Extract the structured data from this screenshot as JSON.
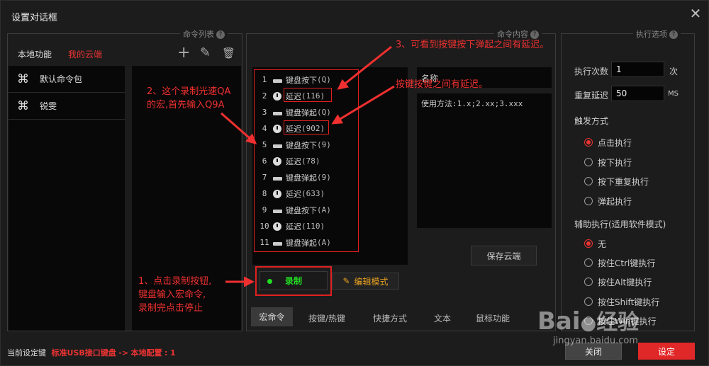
{
  "window": {
    "title": "设置对话框",
    "close_label": "✕"
  },
  "command_list": {
    "legend": "命令列表",
    "tabs": {
      "local": "本地功能",
      "cloud": "我的云端"
    },
    "tools": {
      "add": "+",
      "edit": "✎",
      "delete": "🗑"
    },
    "packages": [
      {
        "icon": "⌘",
        "label": "默认命令包"
      },
      {
        "icon": "⌘",
        "label": "锐雯"
      }
    ]
  },
  "command_content": {
    "legend": "命令内容",
    "macro_rows": [
      {
        "num": "1",
        "icon": "keyboard-icon",
        "label": "键盘按下",
        "arg": "(Q)"
      },
      {
        "num": "2",
        "icon": "clock-icon",
        "label": "延迟",
        "arg": "(116)"
      },
      {
        "num": "3",
        "icon": "keyboard-icon",
        "label": "键盘弹起",
        "arg": "(Q)"
      },
      {
        "num": "4",
        "icon": "clock-icon",
        "label": "延迟",
        "arg": "(902)"
      },
      {
        "num": "5",
        "icon": "keyboard-icon",
        "label": "键盘按下",
        "arg": "(9)"
      },
      {
        "num": "6",
        "icon": "clock-icon",
        "label": "延迟",
        "arg": "(78)"
      },
      {
        "num": "7",
        "icon": "keyboard-icon",
        "label": "键盘弹起",
        "arg": "(9)"
      },
      {
        "num": "8",
        "icon": "clock-icon",
        "label": "延迟",
        "arg": "(633)"
      },
      {
        "num": "9",
        "icon": "keyboard-icon",
        "label": "键盘按下",
        "arg": "(A)"
      },
      {
        "num": "10",
        "icon": "clock-icon",
        "label": "延迟",
        "arg": "(110)"
      },
      {
        "num": "11",
        "icon": "keyboard-icon",
        "label": "键盘弹起",
        "arg": "(A)"
      }
    ],
    "name_label": "名称",
    "usage_text": "使用方法:1.x;2.xx;3.xxx",
    "save_cloud": "保存云端",
    "record_button": "录制",
    "edit_mode_button": "编辑模式",
    "bottom_tabs": [
      "宏命令",
      "按键/热键",
      "快捷方式",
      "文本",
      "鼠标功能"
    ]
  },
  "exec_options": {
    "legend": "执行选项",
    "exec_count_label": "执行次数",
    "exec_count_value": "1",
    "exec_count_unit": "次",
    "repeat_delay_label": "重复延迟",
    "repeat_delay_value": "50",
    "repeat_delay_unit": "MS",
    "trigger_title": "触发方式",
    "trigger_options": [
      "点击执行",
      "按下执行",
      "按下重复执行",
      "弹起执行"
    ],
    "assist_title": "辅助执行(适用软件模式)",
    "assist_options": [
      "无",
      "按住Ctrl键执行",
      "按住Alt键执行",
      "按住Shift键执行",
      "按住Win键执行"
    ]
  },
  "footer": {
    "label": "当前设定键",
    "device": "标准USB接口键盘",
    "arrow": "->",
    "config": "本地配置",
    "sep": ":",
    "num": "1",
    "close_button": "关闭",
    "set_button": "设定"
  },
  "annotations": {
    "a1": [
      "1、点击录制按钮,",
      "键盘输入宏命令,",
      "录制完点击停止"
    ],
    "a2": [
      "2、这个录制光速QA",
      "的宏,首先输入Q9A"
    ],
    "a3": "3、可看到按键按下弹起之间有延迟。",
    "a4": "按键按键之间有延迟。"
  },
  "watermark": {
    "brand": "Bai",
    "brand2": "经验",
    "url": "jingyan.baidu.com"
  },
  "colors": {
    "accent": "#e33333",
    "background": "#1c1c1c",
    "record_dot": "#22dd22"
  }
}
